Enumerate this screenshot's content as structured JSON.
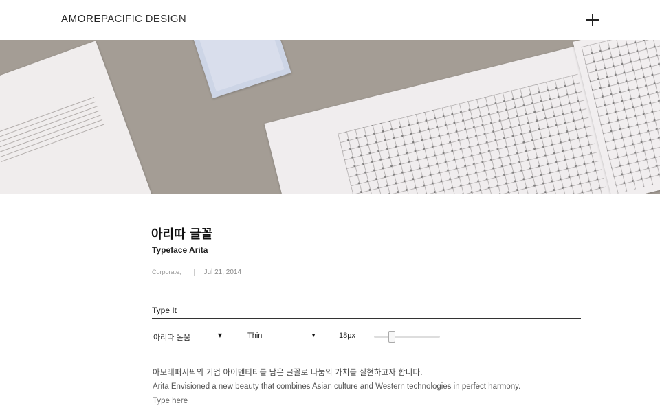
{
  "header": {
    "logo_strong": "AMORE",
    "logo_light": "PACIFIC DESIGN",
    "menu_icon": "plus-icon"
  },
  "hero": {
    "image_description_icon": "photo-typeface-specimen"
  },
  "article": {
    "title_kr": "아리따 글꼴",
    "title_en": "Typeface Arita",
    "category": "Corporate,",
    "date": "Jul 21, 2014"
  },
  "type_it": {
    "label": "Type It",
    "font_select": "아리따 돋움",
    "weight_select": "Thin",
    "size_label": "18px",
    "size_slider_level": 0.27,
    "sample_kr": "아모레퍼시픽의 기업 아이덴티티를 담은 글꼴로 나눔의 가치를 실현하고자 합니다.",
    "sample_en": "Arita Envisioned a new beauty that combines Asian culture and Western technologies in perfect harmony.",
    "placeholder": "Type here"
  },
  "colors": {
    "hero_background": "#a49d95",
    "text": "#222222"
  }
}
